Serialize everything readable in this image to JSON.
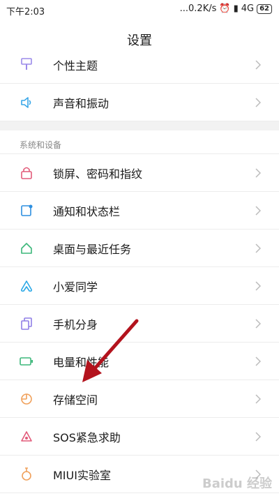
{
  "status_bar": {
    "time": "下午2:03",
    "speed": "...0.2K/s",
    "network": "4G",
    "battery": "62"
  },
  "header": {
    "title": "设置"
  },
  "items_top": [
    {
      "label": "个性主题",
      "icon": "brush-icon",
      "color": "#9b8aea"
    },
    {
      "label": "声音和振动",
      "icon": "speaker-icon",
      "color": "#39a7e8"
    }
  ],
  "section": {
    "title": "系统和设备"
  },
  "items": [
    {
      "label": "锁屏、密码和指纹",
      "icon": "lock-icon",
      "color": "#e25b7a"
    },
    {
      "label": "通知和状态栏",
      "icon": "notification-icon",
      "color": "#2d8fe0"
    },
    {
      "label": "桌面与最近任务",
      "icon": "home-icon",
      "color": "#3cb77a"
    },
    {
      "label": "小爱同学",
      "icon": "xiaoai-icon",
      "color": "#2aa8e6"
    },
    {
      "label": "手机分身",
      "icon": "dual-phone-icon",
      "color": "#8f7ee6"
    },
    {
      "label": "电量和性能",
      "icon": "battery-icon",
      "color": "#3cb77a"
    },
    {
      "label": "存储空间",
      "icon": "storage-pie-icon",
      "color": "#f0a05a"
    },
    {
      "label": "SOS紧急求助",
      "icon": "sos-icon",
      "color": "#e25b7a"
    },
    {
      "label": "MIUI实验室",
      "icon": "flask-icon",
      "color": "#f0a05a"
    }
  ],
  "annotation": {
    "arrow_color": "#b3131d"
  },
  "watermark": "Baidu 经验"
}
